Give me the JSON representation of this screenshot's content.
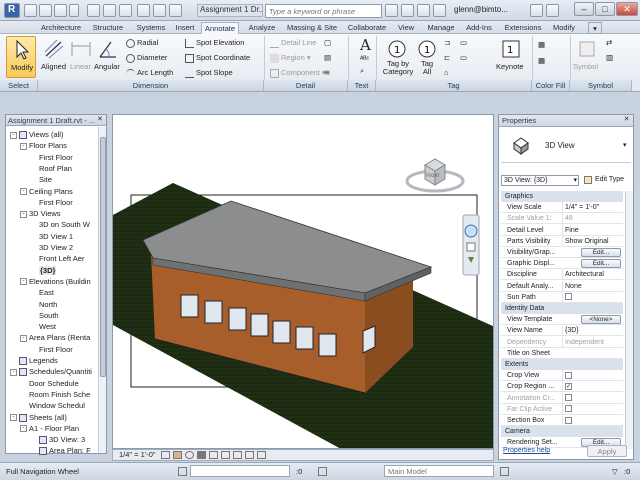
{
  "window": {
    "app_title": "Assignment 1 Dr...",
    "search_placeholder": "Type a keyword or phrase",
    "user": "glenn@bimto..."
  },
  "tabs": [
    "Architecture",
    "Structure",
    "Systems",
    "Insert",
    "Annotate",
    "Analyze",
    "Massing & Site",
    "Collaborate",
    "View",
    "Manage",
    "Add-Ins",
    "Extensions",
    "Modify"
  ],
  "active_tab": "Annotate",
  "ribbon": {
    "modify": "Modify",
    "aligned": "Aligned",
    "linear": "Linear",
    "angular": "Angular",
    "radial": "Radial",
    "diameter": "Diameter",
    "arc_length": "Arc Length",
    "spot_elevation": "Spot Elevation",
    "spot_coordinate": "Spot Coordinate",
    "spot_slope": "Spot Slope",
    "detail_line": "Detail Line",
    "region": "Region",
    "component": "Component",
    "text_a": "A",
    "tag_by_category": "Tag by\nCategory",
    "tag_all": "Tag\nAll",
    "keynote": "Keynote",
    "symbol": "Symbol",
    "panels": {
      "select": "Select",
      "dimension": "Dimension",
      "detail": "Detail",
      "text": "Text",
      "tag": "Tag",
      "color_fill": "Color Fill",
      "symbol": "Symbol"
    }
  },
  "browser": {
    "title": "Assignment 1 Draft.rvt - ...",
    "items": [
      {
        "label": "Views (all)",
        "level": 0,
        "exp": "-",
        "icon": true
      },
      {
        "label": "Floor Plans",
        "level": 1,
        "exp": "-"
      },
      {
        "label": "First Floor",
        "level": 2
      },
      {
        "label": "Roof Plan",
        "level": 2
      },
      {
        "label": "Site",
        "level": 2
      },
      {
        "label": "Ceiling Plans",
        "level": 1,
        "exp": "-"
      },
      {
        "label": "First Floor",
        "level": 2
      },
      {
        "label": "3D Views",
        "level": 1,
        "exp": "-"
      },
      {
        "label": "3D on South W",
        "level": 2
      },
      {
        "label": "3D View 1",
        "level": 2
      },
      {
        "label": "3D View 2",
        "level": 2
      },
      {
        "label": "Front Left Aer",
        "level": 2
      },
      {
        "label": "{3D}",
        "level": 2,
        "selected": true
      },
      {
        "label": "Elevations (Buildin",
        "level": 1,
        "exp": "-"
      },
      {
        "label": "East",
        "level": 2
      },
      {
        "label": "North",
        "level": 2
      },
      {
        "label": "South",
        "level": 2
      },
      {
        "label": "West",
        "level": 2
      },
      {
        "label": "Area Plans (Renta",
        "level": 1,
        "exp": "-"
      },
      {
        "label": "First Floor",
        "level": 2
      },
      {
        "label": "Legends",
        "level": 0,
        "icon": true
      },
      {
        "label": "Schedules/Quantiti",
        "level": 0,
        "exp": "-",
        "icon": true
      },
      {
        "label": "Door Schedule",
        "level": 1
      },
      {
        "label": "Room Finish Sche",
        "level": 1
      },
      {
        "label": "Window Schedul",
        "level": 1
      },
      {
        "label": "Sheets (all)",
        "level": 0,
        "exp": "-",
        "icon": true
      },
      {
        "label": "A1 - Floor Plan",
        "level": 1,
        "exp": "-"
      },
      {
        "label": "3D View: 3",
        "level": 2,
        "icon": true
      },
      {
        "label": "Area Plan: F",
        "level": 2,
        "icon": true
      }
    ]
  },
  "view": {
    "viewcube_face": "FRONT",
    "scale": "1/4\" = 1'-0\""
  },
  "properties": {
    "title": "Properties",
    "type_name": "3D View",
    "selector": "3D View: {3D}",
    "edit_type": "Edit Type",
    "rows": [
      {
        "group": "Graphics"
      },
      {
        "k": "View Scale",
        "v": "1/4\" = 1'-0\""
      },
      {
        "k": "Scale Value  1:",
        "v": "48",
        "dis": true
      },
      {
        "k": "Detail Level",
        "v": "Fine"
      },
      {
        "k": "Parts Visibility",
        "v": "Show Original"
      },
      {
        "k": "Visibility/Grap...",
        "btn": "Edit..."
      },
      {
        "k": "Graphic Displ...",
        "btn": "Edit..."
      },
      {
        "k": "Discipline",
        "v": "Architectural"
      },
      {
        "k": "Default Analy...",
        "v": "None"
      },
      {
        "k": "Sun Path",
        "chk": ""
      },
      {
        "group": "Identity Data"
      },
      {
        "k": "View Template",
        "btn": "<None>"
      },
      {
        "k": "View Name",
        "v": "{3D}"
      },
      {
        "k": "Dependency",
        "v": "Independent",
        "dis": true
      },
      {
        "k": "Title on Sheet",
        "v": ""
      },
      {
        "group": "Extents"
      },
      {
        "k": "Crop View",
        "chk": ""
      },
      {
        "k": "Crop Region ...",
        "chk": "✓"
      },
      {
        "k": "Annotation Cr...",
        "chk": "",
        "dis": true
      },
      {
        "k": "Far Clip Active",
        "chk": "",
        "dis": true
      },
      {
        "k": "Section Box",
        "chk": ""
      },
      {
        "group": "Camera"
      },
      {
        "k": "Rendering Set...",
        "btn": "Edit..."
      }
    ],
    "help_link": "Properties help",
    "apply": "Apply"
  },
  "status": {
    "message": "Full Navigation Wheel",
    "coord": ":0",
    "model": "Main Model"
  }
}
